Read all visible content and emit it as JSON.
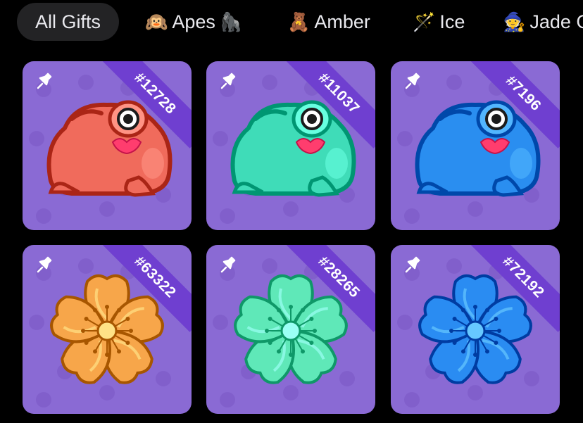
{
  "tabs": [
    {
      "label": "All Gifts",
      "icon": "",
      "active": true
    },
    {
      "label": "Apes",
      "icon": "🙉",
      "suffix": "🦍",
      "active": false
    },
    {
      "label": "Amber",
      "icon": "🧸",
      "active": false
    },
    {
      "label": "Ice",
      "icon": "🪄",
      "active": false
    },
    {
      "label": "Jade G",
      "icon": "🧙",
      "active": false
    }
  ],
  "gifts": [
    {
      "number": "#12728",
      "kind": "frog",
      "color": "#f06b5c",
      "pinned": true
    },
    {
      "number": "#11037",
      "kind": "frog",
      "color": "#3fdcb8",
      "pinned": true
    },
    {
      "number": "#7196",
      "kind": "frog",
      "color": "#2a8ef0",
      "pinned": true
    },
    {
      "number": "#63322",
      "kind": "flower",
      "color": "#f7a64a",
      "pinned": true
    },
    {
      "number": "#28265",
      "kind": "flower",
      "color": "#5fe8b8",
      "pinned": true
    },
    {
      "number": "#72192",
      "kind": "flower",
      "color": "#2a8cf2",
      "pinned": true
    }
  ]
}
